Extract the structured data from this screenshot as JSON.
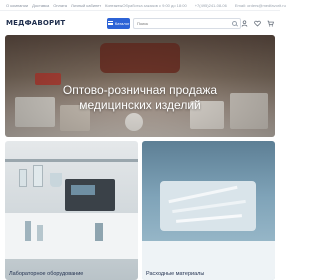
{
  "topbar": {
    "nav": [
      "О компании",
      "Доставка",
      "Оплата",
      "Личный кабинет",
      "Контакты"
    ],
    "hours": "Обработка заказов с 9:00 до 18:00",
    "phone": "+7(495)241-08-06",
    "email": "Email: orders@medfavorit.ru"
  },
  "header": {
    "logo": "МЕДФАВОРИТ",
    "catalog_label": "Каталог",
    "search_placeholder": "Поиск",
    "icons": [
      "user-icon",
      "heart-icon",
      "cart-icon"
    ]
  },
  "hero": {
    "title": "Оптово-розничная продажа медицинских изделий"
  },
  "categories": [
    {
      "label": "Лабораторное оборудование"
    },
    {
      "label": "Расходные материалы"
    }
  ],
  "colors": {
    "accent": "#2d63d6",
    "logo": "#1f2e4d"
  }
}
